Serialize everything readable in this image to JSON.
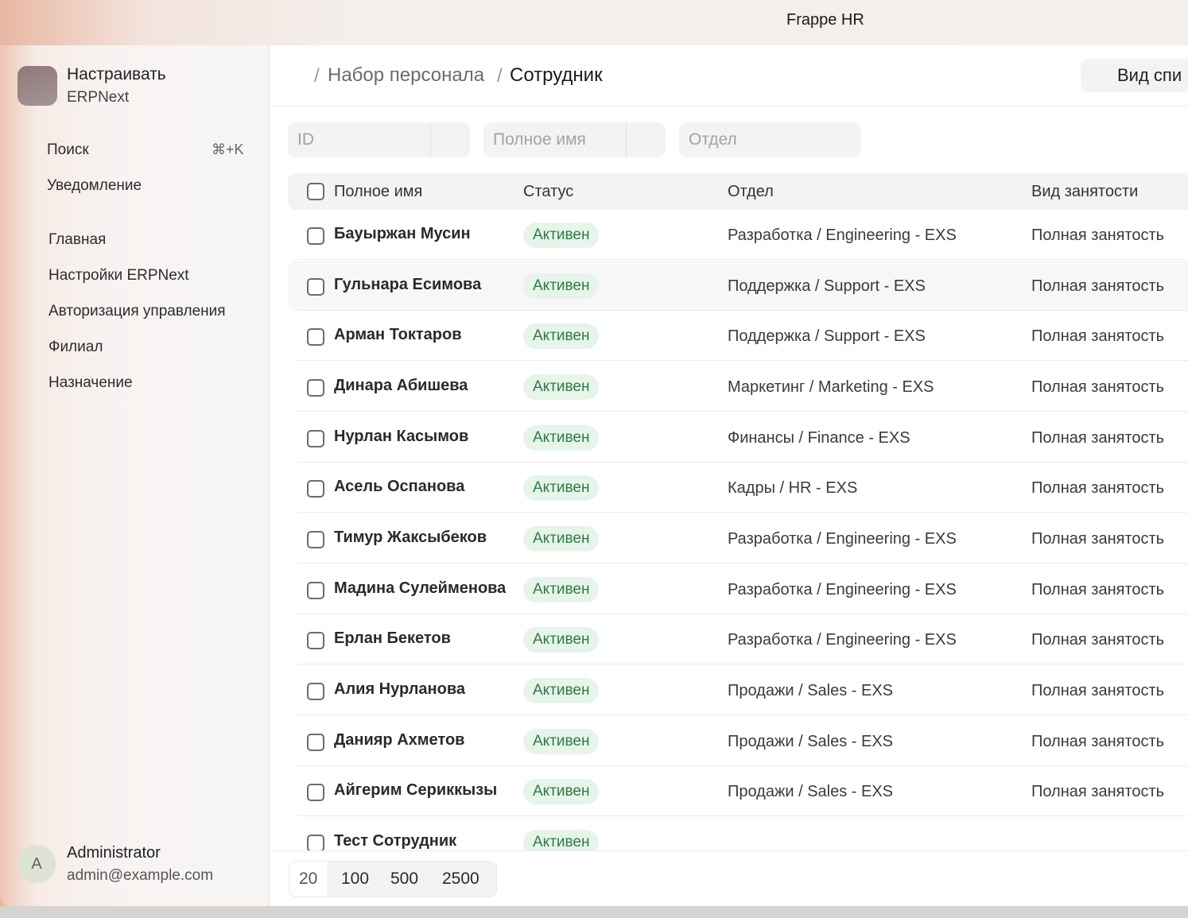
{
  "window": {
    "title": "Frappe HR"
  },
  "sidebar": {
    "app_name": "Настраивать",
    "app_sub": "ERPNext",
    "search_label": "Поиск",
    "search_shortcut": "⌘+K",
    "notifications_label": "Уведомление",
    "items": [
      {
        "label": "Главная"
      },
      {
        "label": "Настройки ERPNext"
      },
      {
        "label": "Авторизация управления"
      },
      {
        "label": "Филиал"
      },
      {
        "label": "Назначение"
      }
    ],
    "user": {
      "initial": "A",
      "name": "Administrator",
      "email": "admin@example.com"
    }
  },
  "header": {
    "breadcrumbs": [
      {
        "label": "Набор персонала"
      },
      {
        "label": "Сотрудник"
      }
    ],
    "view_button": "Вид спи"
  },
  "filters": {
    "id_placeholder": "ID",
    "full_name_placeholder": "Полное имя",
    "department_placeholder": "Отдел"
  },
  "table": {
    "columns": {
      "full_name": "Полное имя",
      "status": "Статус",
      "department": "Отдел",
      "employment_type": "Вид занятости"
    },
    "rows": [
      {
        "name": "Бауыржан Мусин",
        "status": "Активен",
        "department": "Разработка / Engineering - EXS",
        "employment": "Полная занятость"
      },
      {
        "name": "Гульнара Есимова",
        "status": "Активен",
        "department": "Поддержка / Support - EXS",
        "employment": "Полная занятость"
      },
      {
        "name": "Арман Токтаров",
        "status": "Активен",
        "department": "Поддержка / Support - EXS",
        "employment": "Полная занятость"
      },
      {
        "name": "Динара Абишева",
        "status": "Активен",
        "department": "Маркетинг / Marketing - EXS",
        "employment": "Полная занятость"
      },
      {
        "name": "Нурлан Касымов",
        "status": "Активен",
        "department": "Финансы / Finance - EXS",
        "employment": "Полная занятость"
      },
      {
        "name": "Асель Оспанова",
        "status": "Активен",
        "department": "Кадры / HR - EXS",
        "employment": "Полная занятость"
      },
      {
        "name": "Тимур Жаксыбеков",
        "status": "Активен",
        "department": "Разработка / Engineering - EXS",
        "employment": "Полная занятость"
      },
      {
        "name": "Мадина Сулейменова",
        "status": "Активен",
        "department": "Разработка / Engineering - EXS",
        "employment": "Полная занятость"
      },
      {
        "name": "Ерлан Бекетов",
        "status": "Активен",
        "department": "Разработка / Engineering - EXS",
        "employment": "Полная занятость"
      },
      {
        "name": "Алия Нурланова",
        "status": "Активен",
        "department": "Продажи / Sales - EXS",
        "employment": "Полная занятость"
      },
      {
        "name": "Данияр Ахметов",
        "status": "Активен",
        "department": "Продажи / Sales - EXS",
        "employment": "Полная занятость"
      },
      {
        "name": "Айгерим Сериккызы",
        "status": "Активен",
        "department": "Продажи / Sales - EXS",
        "employment": "Полная занятость"
      },
      {
        "name": "Тест Сотрудник",
        "status": "Активен",
        "department": "",
        "employment": ""
      }
    ]
  },
  "pagination": {
    "options": [
      "20",
      "100",
      "500",
      "2500"
    ],
    "selected": "20"
  },
  "colors": {
    "badge_bg": "#e6f4ea",
    "badge_text": "#2f7a46",
    "accent_sidebar": "#e9b7a3"
  }
}
